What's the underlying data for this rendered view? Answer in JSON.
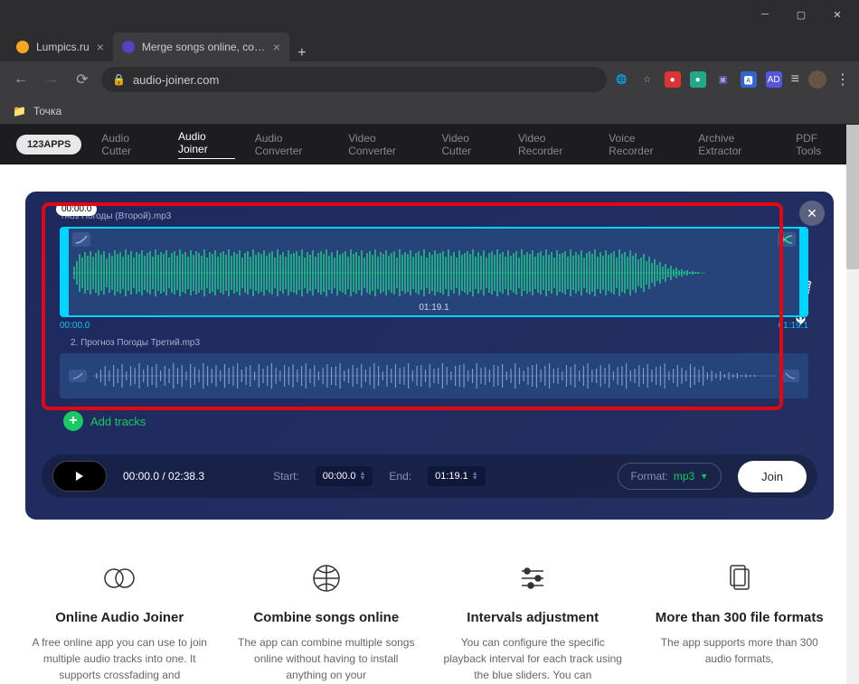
{
  "window": {
    "tabs": [
      {
        "title": "Lumpics.ru",
        "active": false
      },
      {
        "title": "Merge songs online, combine mp",
        "active": true
      }
    ]
  },
  "address_bar": {
    "url": "audio-joiner.com"
  },
  "bookmarks": {
    "item1": "Точка"
  },
  "app_nav": {
    "brand": "123APPS",
    "items": [
      "Audio Cutter",
      "Audio Joiner",
      "Audio Converter",
      "Video Converter",
      "Video Cutter",
      "Video Recorder",
      "Voice Recorder",
      "Archive Extractor",
      "PDF Tools"
    ],
    "active_index": 1
  },
  "editor": {
    "playhead_time": "00:00.0",
    "track1": {
      "title": "гноз Погоды (Второй).mp3",
      "duration_label": "01:19.1",
      "start_time": "00:00.0",
      "end_time": "01:19.1"
    },
    "track2": {
      "title": "2. Прогноз Погоды Третий.mp3"
    },
    "add_tracks_label": "Add tracks"
  },
  "player": {
    "time_display": "00:00.0 / 02:38.3",
    "start_label": "Start:",
    "start_value": "00:00.0",
    "end_label": "End:",
    "end_value": "01:19.1",
    "format_label": "Format:",
    "format_value": "mp3",
    "join_label": "Join"
  },
  "features": [
    {
      "title": "Online Audio Joiner",
      "desc": "A free online app you can use to join multiple audio tracks into one. It supports crossfading and"
    },
    {
      "title": "Combine songs online",
      "desc": "The app can combine multiple songs online without having to install anything on your"
    },
    {
      "title": "Intervals adjustment",
      "desc": "You can configure the specific playback interval for each track using the blue sliders. You can"
    },
    {
      "title": "More than 300 file formats",
      "desc": "The app supports more than 300 audio formats,"
    }
  ]
}
